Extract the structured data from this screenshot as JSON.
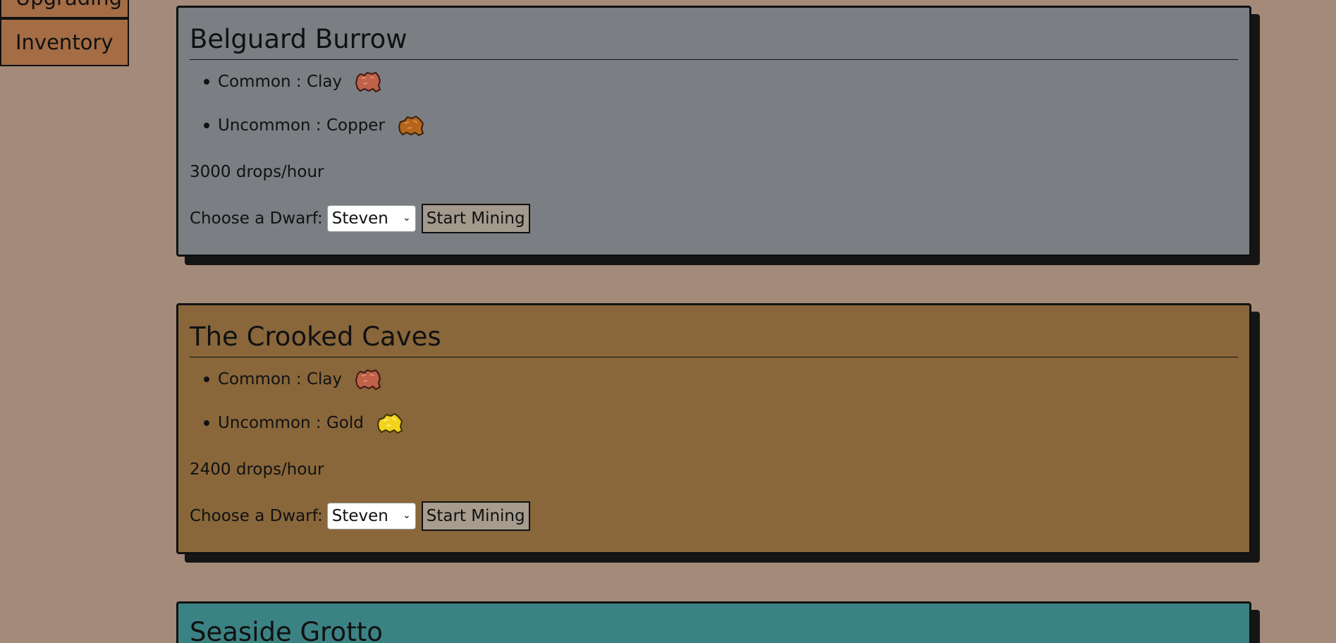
{
  "nav": {
    "upgrading_label": "Upgrading",
    "inventory_label": "Inventory"
  },
  "mines": [
    {
      "name": "Belguard Burrow",
      "bg_color": "#7b7f83",
      "ores": [
        {
          "rarity": "Common",
          "ore": "Clay",
          "text": "Common : Clay",
          "icon": "clay-ore-icon",
          "color": "#c0614a"
        },
        {
          "rarity": "Uncommon",
          "ore": "Copper",
          "text": "Uncommon : Copper",
          "icon": "copper-ore-icon",
          "color": "#b5651d"
        }
      ],
      "drops": "3000 drops/hour",
      "dwarf_label": "Choose a Dwarf:",
      "dwarf_selected": "Steven",
      "start_label": "Start Mining"
    },
    {
      "name": "The Crooked Caves",
      "bg_color": "#89673b",
      "ores": [
        {
          "rarity": "Common",
          "ore": "Clay",
          "text": "Common : Clay",
          "icon": "clay-ore-icon",
          "color": "#c0614a"
        },
        {
          "rarity": "Uncommon",
          "ore": "Gold",
          "text": "Uncommon : Gold",
          "icon": "gold-ore-icon",
          "color": "#f2d21b"
        }
      ],
      "drops": "2400 drops/hour",
      "dwarf_label": "Choose a Dwarf:",
      "dwarf_selected": "Steven",
      "start_label": "Start Mining"
    },
    {
      "name": "Seaside Grotto",
      "bg_color": "#3b8284"
    }
  ]
}
